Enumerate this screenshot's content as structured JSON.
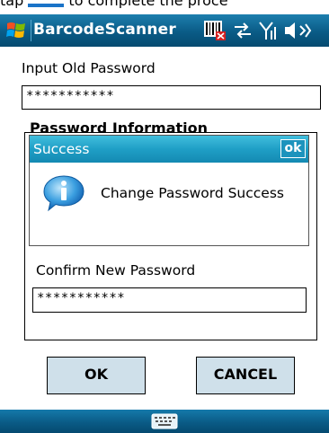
{
  "top_instruction": {
    "before": "tap",
    "after": "to complete the proce"
  },
  "titlebar": {
    "title": "BarcodeScanner",
    "volume_icon": "◁ϵ"
  },
  "form": {
    "old_password_label": "Input Old Password",
    "old_password_value": "***********",
    "section_heading": "Password Information",
    "confirm_label": "Confirm New Password",
    "confirm_value": "***********"
  },
  "dialog": {
    "title": "Success",
    "ok_label": "ok",
    "message": "Change Password Success"
  },
  "buttons": {
    "ok_label": "OK",
    "cancel_label": "CANCEL"
  }
}
